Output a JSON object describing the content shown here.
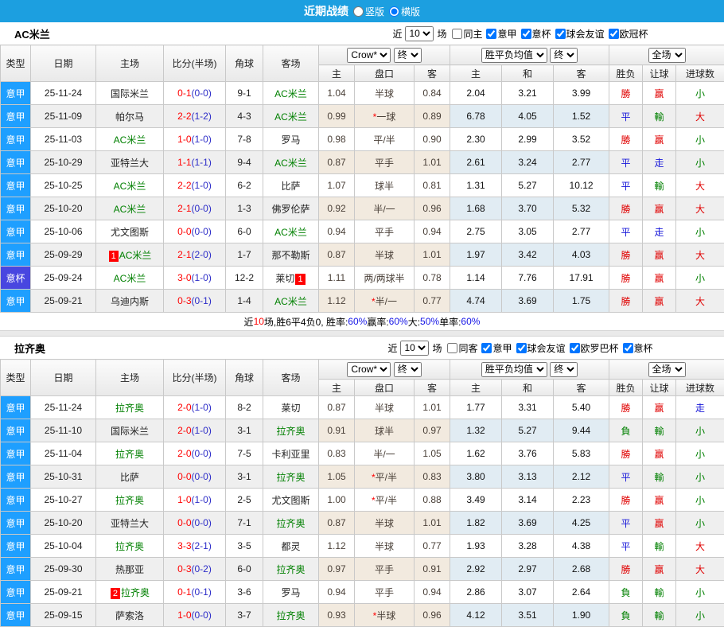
{
  "title_bar": {
    "title": "近期战绩",
    "radios": [
      {
        "label": "竖版",
        "checked": false
      },
      {
        "label": "横版",
        "checked": true
      }
    ]
  },
  "colors": {
    "header_bar": "#1c9fe0",
    "league_type": "#1e9fff",
    "cup_type": "#4846e0",
    "team_self": "#008000",
    "score_ft": "#ff0000",
    "score_ht": "#2d2dc8",
    "badge": "#ff0000",
    "percent_blue": "#1414e6"
  },
  "table_labels": {
    "type": "类型",
    "date": "日期",
    "home": "主场",
    "score": "比分(半场)",
    "corner": "角球",
    "away": "客场",
    "odds_home": "主",
    "handicap": "盘口",
    "odds_away": "客",
    "avg_home": "主",
    "avg_draw": "和",
    "avg_away": "客",
    "wdl": "胜负",
    "let_goal": "让球",
    "goals": "进球数",
    "near": "近",
    "count": "10",
    "games": "场",
    "bookmaker": "Crow*",
    "final": "终",
    "avg_group": "胜平负均值",
    "scope": "全场"
  },
  "result_colors": {
    "勝": "#e00000",
    "平": "#1616d9",
    "負": "#008000",
    "赢": "#e00000",
    "輸": "#008000",
    "走": "#1616d9",
    "大": "#e00000",
    "小": "#008000"
  },
  "row_fields": [
    "type",
    "date",
    "home",
    "home_self",
    "home_badge",
    "score_ft",
    "score_ht",
    "corners",
    "away",
    "away_self",
    "away_badge",
    "odds_home",
    "handicap_star",
    "handicap",
    "odds_away",
    "avg_win",
    "avg_draw",
    "avg_lose",
    "res_win_lose",
    "res_handicap",
    "res_goals"
  ],
  "sections": [
    {
      "team": "AC米兰",
      "filter_options": [
        {
          "label": "同主",
          "checked": false
        },
        {
          "label": "意甲",
          "checked": true
        },
        {
          "label": "意杯",
          "checked": true
        },
        {
          "label": "球会友谊",
          "checked": true
        },
        {
          "label": "欧冠杯",
          "checked": true
        }
      ],
      "rows": [
        [
          "意甲",
          "25-11-24",
          "国际米兰",
          0,
          "",
          "0-1",
          "(0-0)",
          "9-1",
          "AC米兰",
          1,
          "",
          "1.04",
          0,
          "半球",
          "0.84",
          "2.04",
          "3.21",
          "3.99",
          "勝",
          "赢",
          "小"
        ],
        [
          "意甲",
          "25-11-09",
          "帕尔马",
          0,
          "",
          "2-2",
          "(1-2)",
          "4-3",
          "AC米兰",
          1,
          "",
          "0.99",
          1,
          "一球",
          "0.89",
          "6.78",
          "4.05",
          "1.52",
          "平",
          "輸",
          "大"
        ],
        [
          "意甲",
          "25-11-03",
          "AC米兰",
          1,
          "",
          "1-0",
          "(1-0)",
          "7-8",
          "罗马",
          0,
          "",
          "0.98",
          0,
          "平/半",
          "0.90",
          "2.30",
          "2.99",
          "3.52",
          "勝",
          "赢",
          "小"
        ],
        [
          "意甲",
          "25-10-29",
          "亚特兰大",
          0,
          "",
          "1-1",
          "(1-1)",
          "9-4",
          "AC米兰",
          1,
          "",
          "0.87",
          0,
          "平手",
          "1.01",
          "2.61",
          "3.24",
          "2.77",
          "平",
          "走",
          "小"
        ],
        [
          "意甲",
          "25-10-25",
          "AC米兰",
          1,
          "",
          "2-2",
          "(1-0)",
          "6-2",
          "比萨",
          0,
          "",
          "1.07",
          0,
          "球半",
          "0.81",
          "1.31",
          "5.27",
          "10.12",
          "平",
          "輸",
          "大"
        ],
        [
          "意甲",
          "25-10-20",
          "AC米兰",
          1,
          "",
          "2-1",
          "(0-0)",
          "1-3",
          "佛罗伦萨",
          0,
          "",
          "0.92",
          0,
          "半/一",
          "0.96",
          "1.68",
          "3.70",
          "5.32",
          "勝",
          "赢",
          "大"
        ],
        [
          "意甲",
          "25-10-06",
          "尤文图斯",
          0,
          "",
          "0-0",
          "(0-0)",
          "6-0",
          "AC米兰",
          1,
          "",
          "0.94",
          0,
          "平手",
          "0.94",
          "2.75",
          "3.05",
          "2.77",
          "平",
          "走",
          "小"
        ],
        [
          "意甲",
          "25-09-29",
          "AC米兰",
          1,
          "1",
          "2-1",
          "(2-0)",
          "1-7",
          "那不勒斯",
          0,
          "",
          "0.87",
          0,
          "半球",
          "1.01",
          "1.97",
          "3.42",
          "4.03",
          "勝",
          "赢",
          "大"
        ],
        [
          "意杯",
          "25-09-24",
          "AC米兰",
          1,
          "",
          "3-0",
          "(1-0)",
          "12-2",
          "莱切",
          0,
          "1",
          "1.11",
          0,
          "两/两球半",
          "0.78",
          "1.14",
          "7.76",
          "17.91",
          "勝",
          "赢",
          "小"
        ],
        [
          "意甲",
          "25-09-21",
          "乌迪内斯",
          0,
          "",
          "0-3",
          "(0-1)",
          "1-4",
          "AC米兰",
          1,
          "",
          "1.12",
          1,
          "半/一",
          "0.77",
          "4.74",
          "3.69",
          "1.75",
          "勝",
          "赢",
          "大"
        ]
      ],
      "summary": [
        {
          "t": "近",
          "c": "#000000"
        },
        {
          "t": "10",
          "c": "#ff0000"
        },
        {
          "t": "场,胜6平4负0, 胜率:",
          "c": "#000000"
        },
        {
          "t": "60%",
          "c": "#1414e6"
        },
        {
          "t": " 赢率:",
          "c": "#000000"
        },
        {
          "t": "60%",
          "c": "#1414e6"
        },
        {
          "t": " 大:",
          "c": "#000000"
        },
        {
          "t": "50%",
          "c": "#1414e6"
        },
        {
          "t": " 单率:",
          "c": "#000000"
        },
        {
          "t": "60%",
          "c": "#1414e6"
        }
      ]
    },
    {
      "team": "拉齐奥",
      "filter_options": [
        {
          "label": "同客",
          "checked": false
        },
        {
          "label": "意甲",
          "checked": true
        },
        {
          "label": "球会友谊",
          "checked": true
        },
        {
          "label": "欧罗巴杯",
          "checked": true
        },
        {
          "label": "意杯",
          "checked": true
        }
      ],
      "rows": [
        [
          "意甲",
          "25-11-24",
          "拉齐奥",
          1,
          "",
          "2-0",
          "(1-0)",
          "8-2",
          "莱切",
          0,
          "",
          "0.87",
          0,
          "半球",
          "1.01",
          "1.77",
          "3.31",
          "5.40",
          "勝",
          "赢",
          "走"
        ],
        [
          "意甲",
          "25-11-10",
          "国际米兰",
          0,
          "",
          "2-0",
          "(1-0)",
          "3-1",
          "拉齐奥",
          1,
          "",
          "0.91",
          0,
          "球半",
          "0.97",
          "1.32",
          "5.27",
          "9.44",
          "負",
          "輸",
          "小"
        ],
        [
          "意甲",
          "25-11-04",
          "拉齐奥",
          1,
          "",
          "2-0",
          "(0-0)",
          "7-5",
          "卡利亚里",
          0,
          "",
          "0.83",
          0,
          "半/一",
          "1.05",
          "1.62",
          "3.76",
          "5.83",
          "勝",
          "赢",
          "小"
        ],
        [
          "意甲",
          "25-10-31",
          "比萨",
          0,
          "",
          "0-0",
          "(0-0)",
          "3-1",
          "拉齐奥",
          1,
          "",
          "1.05",
          1,
          "平/半",
          "0.83",
          "3.80",
          "3.13",
          "2.12",
          "平",
          "輸",
          "小"
        ],
        [
          "意甲",
          "25-10-27",
          "拉齐奥",
          1,
          "",
          "1-0",
          "(1-0)",
          "2-5",
          "尤文图斯",
          0,
          "",
          "1.00",
          1,
          "平/半",
          "0.88",
          "3.49",
          "3.14",
          "2.23",
          "勝",
          "赢",
          "小"
        ],
        [
          "意甲",
          "25-10-20",
          "亚特兰大",
          0,
          "",
          "0-0",
          "(0-0)",
          "7-1",
          "拉齐奥",
          1,
          "",
          "0.87",
          0,
          "半球",
          "1.01",
          "1.82",
          "3.69",
          "4.25",
          "平",
          "赢",
          "小"
        ],
        [
          "意甲",
          "25-10-04",
          "拉齐奥",
          1,
          "",
          "3-3",
          "(2-1)",
          "3-5",
          "都灵",
          0,
          "",
          "1.12",
          0,
          "半球",
          "0.77",
          "1.93",
          "3.28",
          "4.38",
          "平",
          "輸",
          "大"
        ],
        [
          "意甲",
          "25-09-30",
          "热那亚",
          0,
          "",
          "0-3",
          "(0-2)",
          "6-0",
          "拉齐奥",
          1,
          "",
          "0.97",
          0,
          "平手",
          "0.91",
          "2.92",
          "2.97",
          "2.68",
          "勝",
          "赢",
          "大"
        ],
        [
          "意甲",
          "25-09-21",
          "拉齐奥",
          1,
          "2",
          "0-1",
          "(0-1)",
          "3-6",
          "罗马",
          0,
          "",
          "0.94",
          0,
          "平手",
          "0.94",
          "2.86",
          "3.07",
          "2.64",
          "負",
          "輸",
          "小"
        ],
        [
          "意甲",
          "25-09-15",
          "萨索洛",
          0,
          "",
          "1-0",
          "(0-0)",
          "3-7",
          "拉齐奥",
          1,
          "",
          "0.93",
          1,
          "半球",
          "0.96",
          "4.12",
          "3.51",
          "1.90",
          "負",
          "輸",
          "小"
        ]
      ],
      "summary": null
    }
  ]
}
